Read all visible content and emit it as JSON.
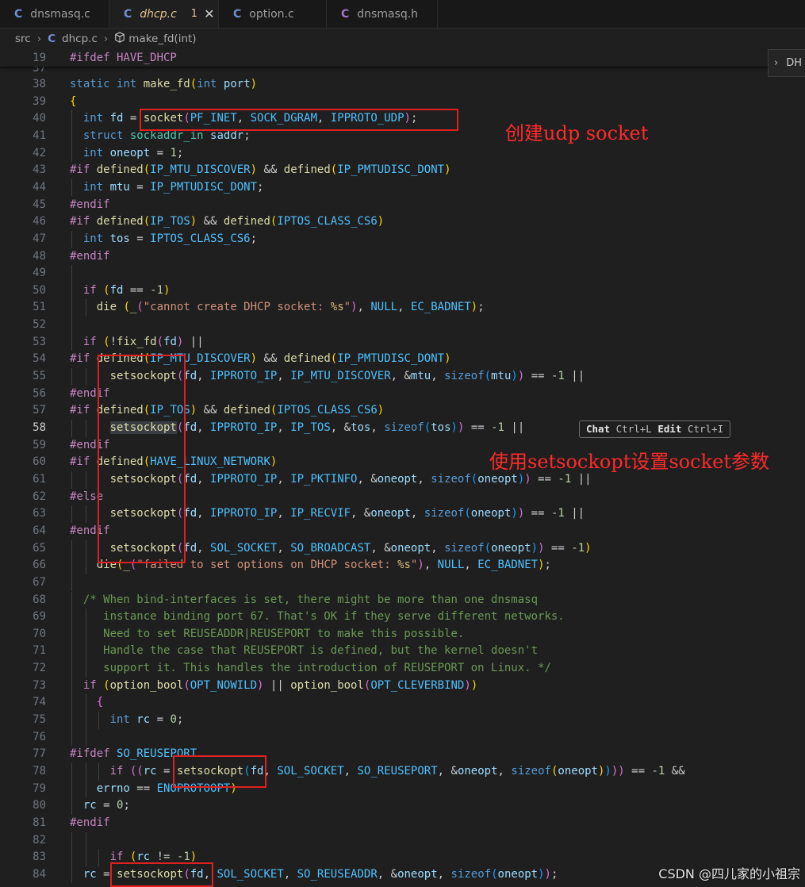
{
  "tabs": [
    {
      "icon": "C",
      "label": "dnsmasq.c",
      "active": false
    },
    {
      "icon": "C",
      "label": "dhcp.c",
      "active": true,
      "badge": "1",
      "close": "✕"
    },
    {
      "icon": "C",
      "label": "option.c",
      "active": false
    },
    {
      "icon": "C",
      "label": "dnsmasq.h",
      "active": false
    }
  ],
  "breadcrumb": {
    "folder": "src",
    "file_icon": "C",
    "file": "dhcp.c",
    "symbol_icon": "cube-icon",
    "symbol": "make_fd(int)"
  },
  "side_panel": {
    "chevron": "›",
    "label": "DH"
  },
  "sticky_line": {
    "number": "19",
    "text": "#ifdef HAVE_DHCP"
  },
  "line_numbers": [
    "38",
    "39",
    "40",
    "41",
    "42",
    "43",
    "44",
    "45",
    "46",
    "47",
    "48",
    "49",
    "50",
    "51",
    "52",
    "53",
    "54",
    "55",
    "56",
    "57",
    "58",
    "59",
    "60",
    "61",
    "62",
    "63",
    "64",
    "65",
    "66",
    "67",
    "68",
    "69",
    "70",
    "71",
    "72",
    "73",
    "74",
    "75",
    "76",
    "77",
    "78",
    "79",
    "80",
    "81",
    "82",
    "83",
    "84"
  ],
  "current_line": "58",
  "hint": {
    "chat": "Chat",
    "chat_key": "Ctrl+L",
    "edit": "Edit",
    "edit_key": "Ctrl+I"
  },
  "annotations": {
    "create_socket": "创建udp socket",
    "setsockopt": "使用setsockopt设置socket参数"
  },
  "watermark": "CSDN @四儿家的小祖宗",
  "colors": {
    "annotation_red": "#e02020",
    "active_tab_text": "#e2c08d",
    "editor_bg": "#1f1f1f"
  }
}
